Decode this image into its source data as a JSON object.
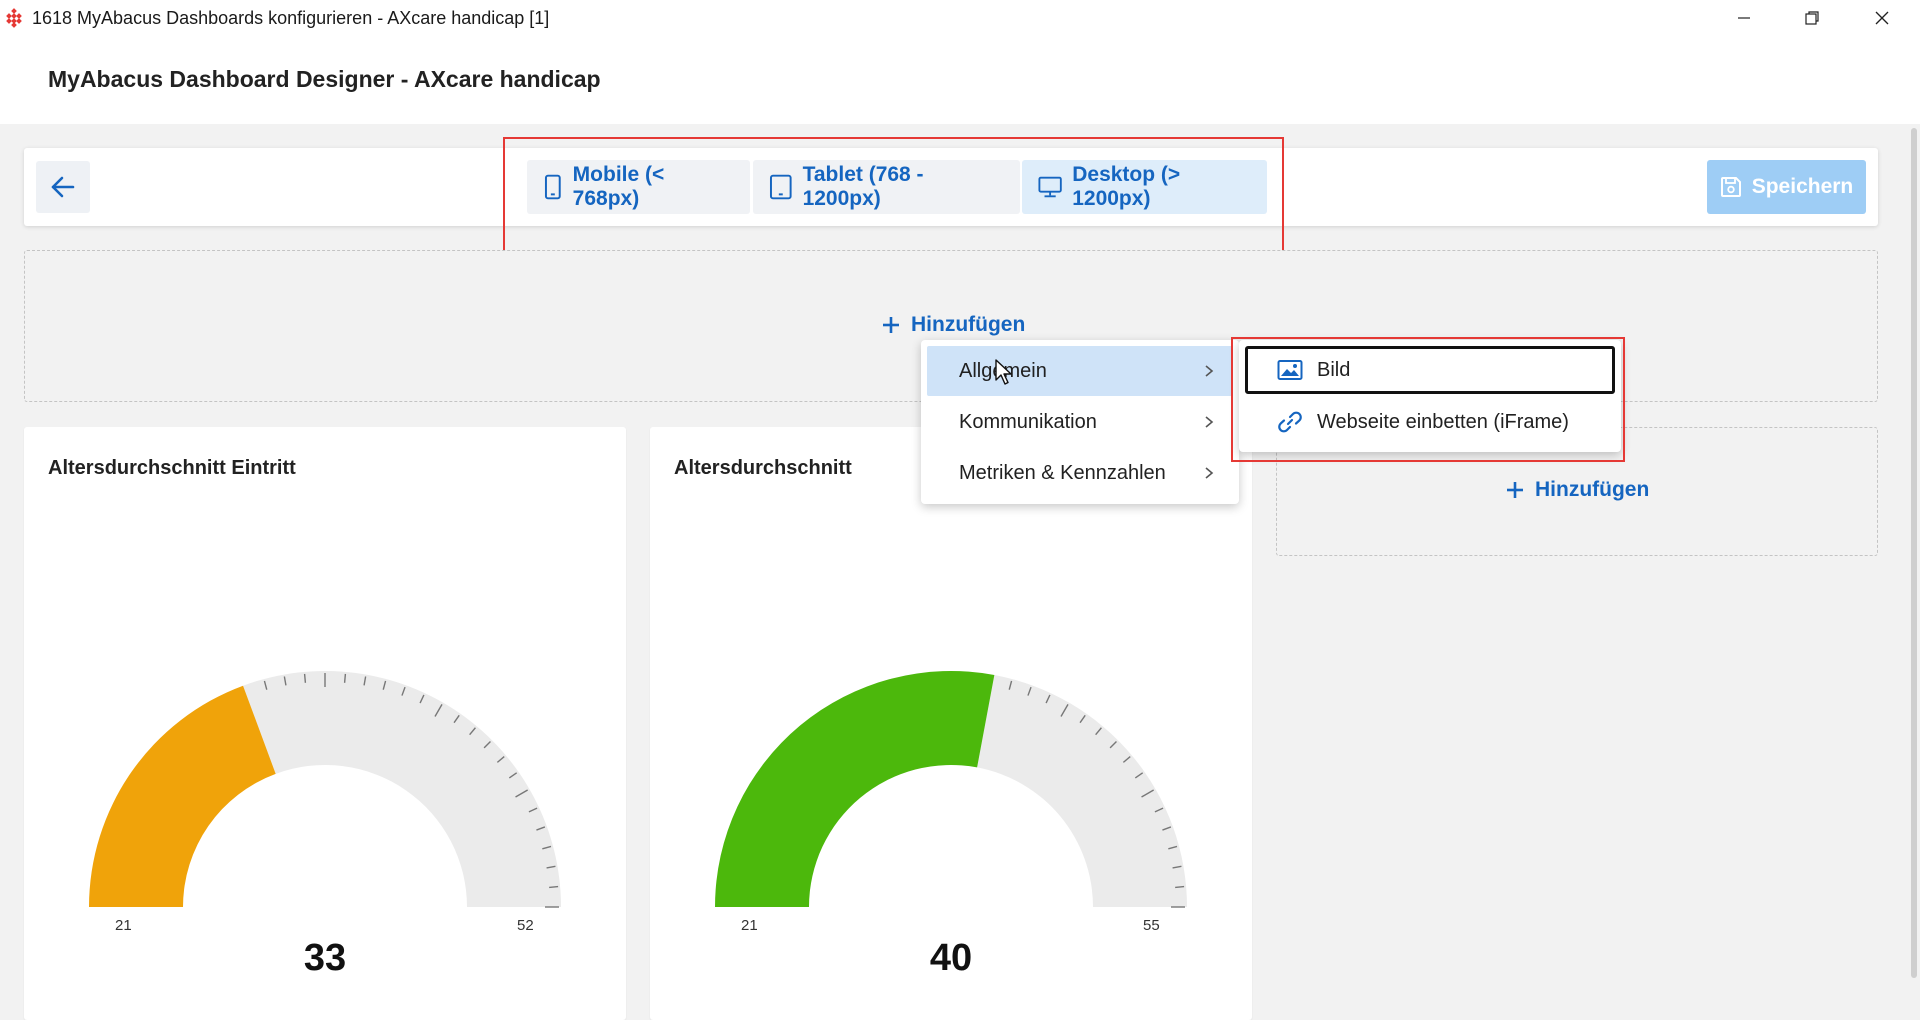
{
  "window": {
    "title": "1618 MyAbacus Dashboards konfigurieren - AXcare handicap [1]",
    "icons": [
      "app-logo-icon",
      "minimize-icon",
      "restore-icon",
      "close-icon"
    ]
  },
  "header": {
    "title": "MyAbacus Dashboard Designer - AXcare handicap"
  },
  "toolbar": {
    "back_icon": "arrow-left-icon",
    "devices": [
      {
        "label": "Mobile (< 768px)",
        "icon": "phone-icon",
        "selected": false
      },
      {
        "label": "Tablet (768 - 1200px)",
        "icon": "tablet-icon",
        "selected": false
      },
      {
        "label": "Desktop (> 1200px)",
        "icon": "monitor-icon",
        "selected": true
      }
    ],
    "save_label": "Speichern",
    "save_icon": "floppy-disk-icon",
    "save_enabled": false
  },
  "add_label": "Hinzufügen",
  "add_right_label": "Hinzufügen",
  "widgets": [
    {
      "title": "Altersdurchschnitt Eintritt",
      "min": "21",
      "max": "52",
      "value": "33",
      "color": "#f0a30a"
    },
    {
      "title": "Altersdurchschnitt",
      "min": "21",
      "max": "55",
      "value": "40",
      "color": "#4cb80c"
    }
  ],
  "context_menu": {
    "items": [
      {
        "label": "Allgemein",
        "active": true
      },
      {
        "label": "Kommunikation",
        "active": false
      },
      {
        "label": "Metriken & Kennzahlen",
        "active": false
      }
    ]
  },
  "submenu": {
    "items": [
      {
        "label": "Bild",
        "icon": "image-icon",
        "focused": true
      },
      {
        "label": "Webseite einbetten (iFrame)",
        "icon": "link-icon",
        "focused": false
      }
    ]
  },
  "colors": {
    "accent": "#1565c0",
    "highlight": "#e53935",
    "selected": "#deedfa",
    "menu_active": "#cfe3f8"
  }
}
